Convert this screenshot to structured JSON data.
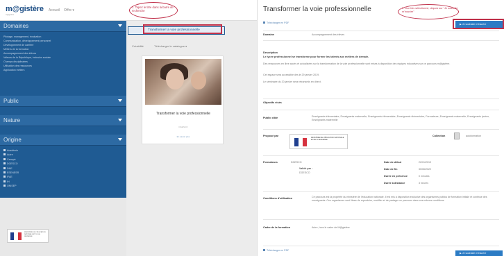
{
  "header": {
    "logo": "m@gistère",
    "logo_sub": "m@gistère",
    "nav": [
      "Accueil",
      "Offre ▾"
    ]
  },
  "sidebar": {
    "sections": [
      {
        "title": "Domaines",
        "items": [
          "Pilotage, management, évaluation",
          "Communication, développement personnel",
          "Développement de carrière",
          "Métiers de la formation",
          "Accompagnement des élèves",
          "Valeurs de la République, inclusion sociale",
          "Champs disciplinaires",
          "Utilisation des ressources",
          "Application métiers"
        ]
      },
      {
        "title": "Public",
        "items": []
      },
      {
        "title": "Nature",
        "items": []
      },
      {
        "title": "Origine",
        "items": [
          "Académie",
          "Autre",
          "Canopé",
          "DGESCO",
          "DNE",
          "ESENESR",
          "IFAE",
          "IH",
          "ONISEP"
        ]
      }
    ]
  },
  "middle": {
    "search_crumb": "Transformer la voie professionnelle",
    "filter_label": "Créabilité",
    "filter_catalog": "Télécharger le catalogue ▾",
    "card": {
      "title": "Transformer la voie professionnelle",
      "meta": "DGESCO",
      "link": "En savoir plus"
    }
  },
  "annotations": {
    "step1": "1. Tapez le titre dans la barre de recherche",
    "step2": "2. Une fois sélectionné, cliquez sur \"Je souhaite m'inscrire\""
  },
  "detail": {
    "title": "Transformer la voie professionnelle",
    "download_link": "Télécharger en PDF",
    "enroll_button": "Je souhaite m'inscrire",
    "rows": {
      "domaine_label": "Domaine",
      "domaine_value": "Accompagnement des élèves",
      "description_label": "Description",
      "description_headline": "Le lycée professionnel se transforme pour former les talents aux métiers de demain.",
      "description_p1": "Des ressources en libre accès et actualisées sur la transformation de la voie professionnelle sont mises à disposition des équipes éducatives sur ce parcours m@gistère.",
      "description_p2": "Cet espace sera accessible dès le 29 janvier 2019.",
      "description_p3": "Le séminaire du 20 janvier sera retransmis en direct.",
      "objectifs_label": "Objectifs visés",
      "public_label": "Public cible",
      "public_value": "Enseignants élémentaire, Enseignants maternelle, Enseignants élémentaire, Enseignants élémentaire, Formateurs, Enseignants maternelle, Enseignants lycées, Enseignants maternelle",
      "propose_label": "Proposé par",
      "ministry_text": "MINISTÈRE DE L'ÉDUCATION NATIONALE ET DE LA JEUNESSE",
      "collection_label": "Collection",
      "collection_value": "autoformation",
      "formateurs_label": "Formateurs",
      "formateurs_value": "DGESCO",
      "valide_label": "Validé par :",
      "valide_value": "DGESCO",
      "date_debut_label": "Date de début",
      "date_debut_value": "22/01/2019",
      "date_fin_label": "Date de fin",
      "date_fin_value": "30/06/2022",
      "duree_presence_label": "Durée en présence",
      "duree_presence_value": "0 minutes",
      "duree_distance_label": "Durée à distance",
      "duree_distance_value": "3 heures",
      "conditions_label": "Conditions d'utilisation",
      "conditions_value": "Ce parcours est la propriété du ministère de l'éducation nationale. Il est mis à disposition exclusive des organismes publics de formation initiale et continue des enseignants. Ces organismes sont libres de reproduire, modifier et de partager ce parcours dans ces mêmes conditions.",
      "cadre_label": "Cadre de la formation",
      "cadre_value": "Autre, hors le cadre de M@gistère"
    }
  },
  "footer": {
    "ministry_text": "MINISTÈRE DE L'ÉDUCATION NATIONALE ET DE LA JEUNESSE"
  },
  "colors": {
    "sidebar": "#1f5b93",
    "accent": "#2b7bc4",
    "annotation": "#c0304a"
  }
}
